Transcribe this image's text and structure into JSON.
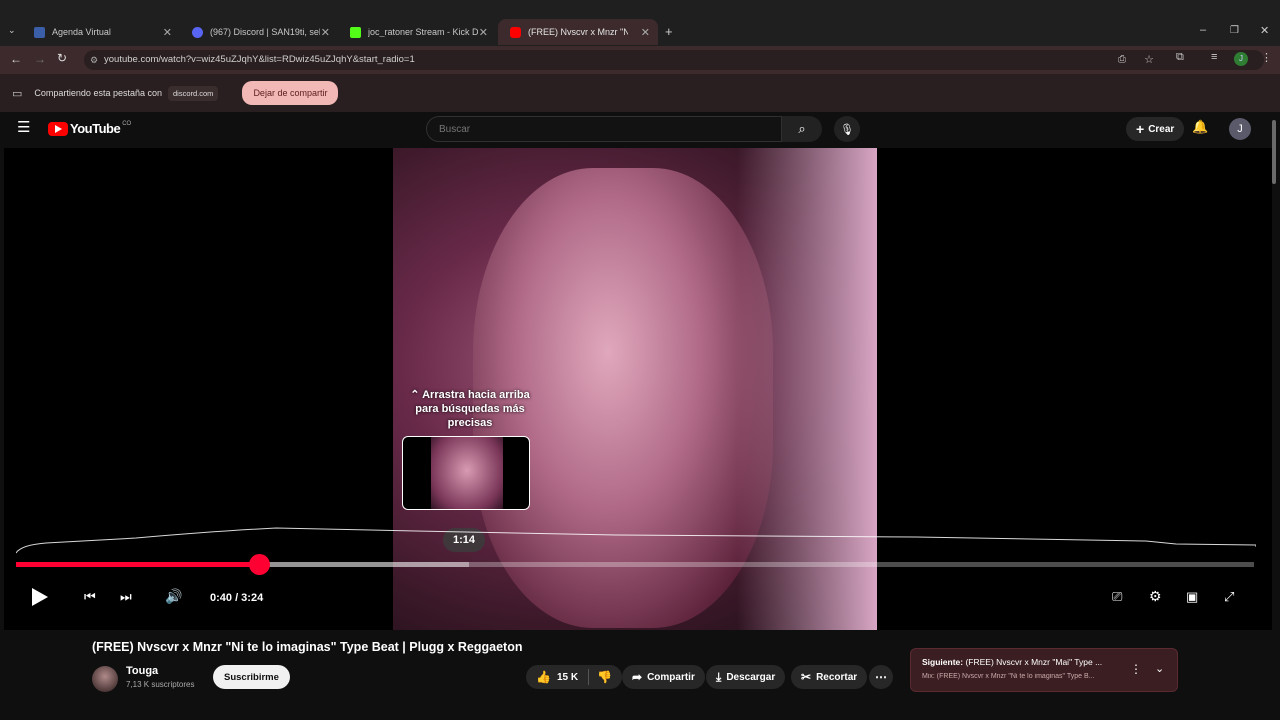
{
  "browser": {
    "tabs": [
      {
        "label": "Agenda Virtual",
        "color": "#3a5ea8"
      },
      {
        "label": "(967) Discord | SAN19ti, sel",
        "color": "#5865f2"
      },
      {
        "label": "joc_ratoner Stream - Kick Dash",
        "color": "#53fc18"
      },
      {
        "label": "(FREE) Nvscvr x Mnzr \"Ni te",
        "color": "#ff0000"
      }
    ],
    "url": "youtube.com/watch?v=wiz45uZJqhY&list=RDwiz45uZJqhY&start_radio=1",
    "profile_initial": "J"
  },
  "share": {
    "text": "Compartiendo esta pestaña con",
    "domain": "discord.com",
    "stop_label": "Dejar de compartir"
  },
  "youtube": {
    "logo": "YouTube",
    "country": "CO",
    "search_placeholder": "Buscar",
    "create_label": "Crear",
    "avatar_initial": "J"
  },
  "player": {
    "hint": "⌃ Arrastra hacia arriba para búsquedas más precisas",
    "hover_time": "1:14",
    "time_display": "0:40 / 3:24",
    "progress": 0.196,
    "hover_position": 0.366,
    "accent": "#ff0033"
  },
  "video_info": {
    "title": "(FREE) Nvscvr x Mnzr \"Ni te lo imaginas\" Type Beat | Plugg x Reggaeton",
    "channel": "Touga",
    "subscribers": "7,13 K suscriptores",
    "subscribe_label": "Suscribirme",
    "likes": "15 K",
    "share_label": "Compartir",
    "download_label": "Descargar",
    "clip_label": "Recortar"
  },
  "next_up": {
    "label": "Siguiente:",
    "title": "(FREE) Nvscvr x Mnzr \"Mai\" Type ...",
    "subtitle": "Mix: (FREE) Nvscvr x Mnzr \"Ni te lo imaginas\" Type B..."
  }
}
